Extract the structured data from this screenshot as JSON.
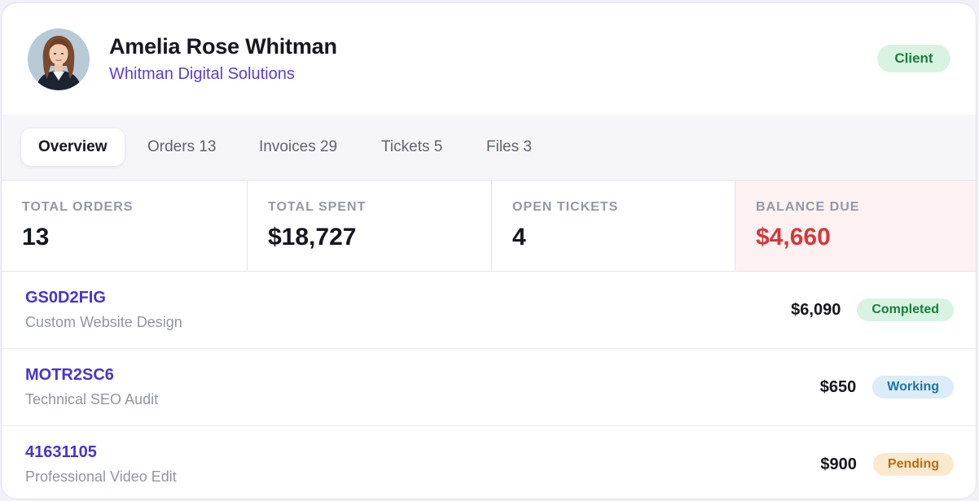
{
  "profile": {
    "name": "Amelia Rose Whitman",
    "company": "Whitman Digital Solutions",
    "badge": "Client"
  },
  "tabs": [
    {
      "label": "Overview",
      "active": true
    },
    {
      "label": "Orders 13",
      "active": false
    },
    {
      "label": "Invoices 29",
      "active": false
    },
    {
      "label": "Tickets 5",
      "active": false
    },
    {
      "label": "Files 3",
      "active": false
    }
  ],
  "stats": [
    {
      "label": "TOTAL ORDERS",
      "value": "13"
    },
    {
      "label": "TOTAL SPENT",
      "value": "$18,727"
    },
    {
      "label": "OPEN TICKETS",
      "value": "4"
    },
    {
      "label": "BALANCE DUE",
      "value": "$4,660"
    }
  ],
  "orders": [
    {
      "id": "GS0D2FIG",
      "description": "Custom Website Design",
      "amount": "$6,090",
      "status": "Completed"
    },
    {
      "id": "MOTR2SC6",
      "description": "Technical SEO Audit",
      "amount": "$650",
      "status": "Working"
    },
    {
      "id": "41631105",
      "description": "Professional Video Edit",
      "amount": "$900",
      "status": "Pending"
    }
  ],
  "colors": {
    "accent": "#4a34c9",
    "company": "#5b3fd6",
    "client_badge_bg": "#d9f3e2",
    "balance_due": "#d63838",
    "status_completed": "#15803d",
    "status_working": "#1f75a6",
    "status_pending": "#b86e12"
  },
  "icons": {
    "avatar": "user-avatar-photo"
  }
}
